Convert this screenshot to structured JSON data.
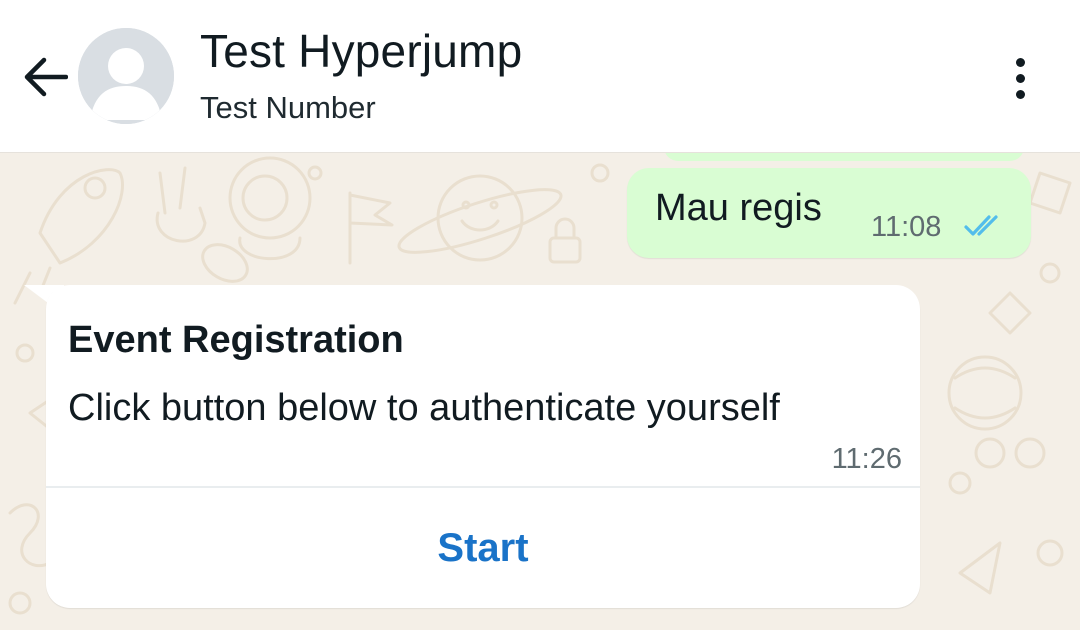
{
  "header": {
    "back_icon": "arrow-left-icon",
    "avatar_icon": "default-person-avatar",
    "contact_name": "Test Hyperjump",
    "contact_subtitle": "Test Number",
    "menu_icon": "more-vertical-icon"
  },
  "messages": [
    {
      "direction": "outgoing",
      "text": "Mau regis",
      "time": "11:08",
      "status_icon": "double-check-read-icon"
    },
    {
      "direction": "incoming",
      "type": "interactive",
      "heading": "Event Registration",
      "body": "Click button below to authenticate yourself",
      "time": "11:26",
      "button_label": "Start"
    }
  ],
  "colors": {
    "header_bg": "#ffffff",
    "chat_bg": "#f4efe7",
    "outgoing_bubble": "#d9fdd3",
    "incoming_bubble": "#ffffff",
    "read_ticks": "#53bdeb",
    "button_text": "#1a73c8"
  }
}
